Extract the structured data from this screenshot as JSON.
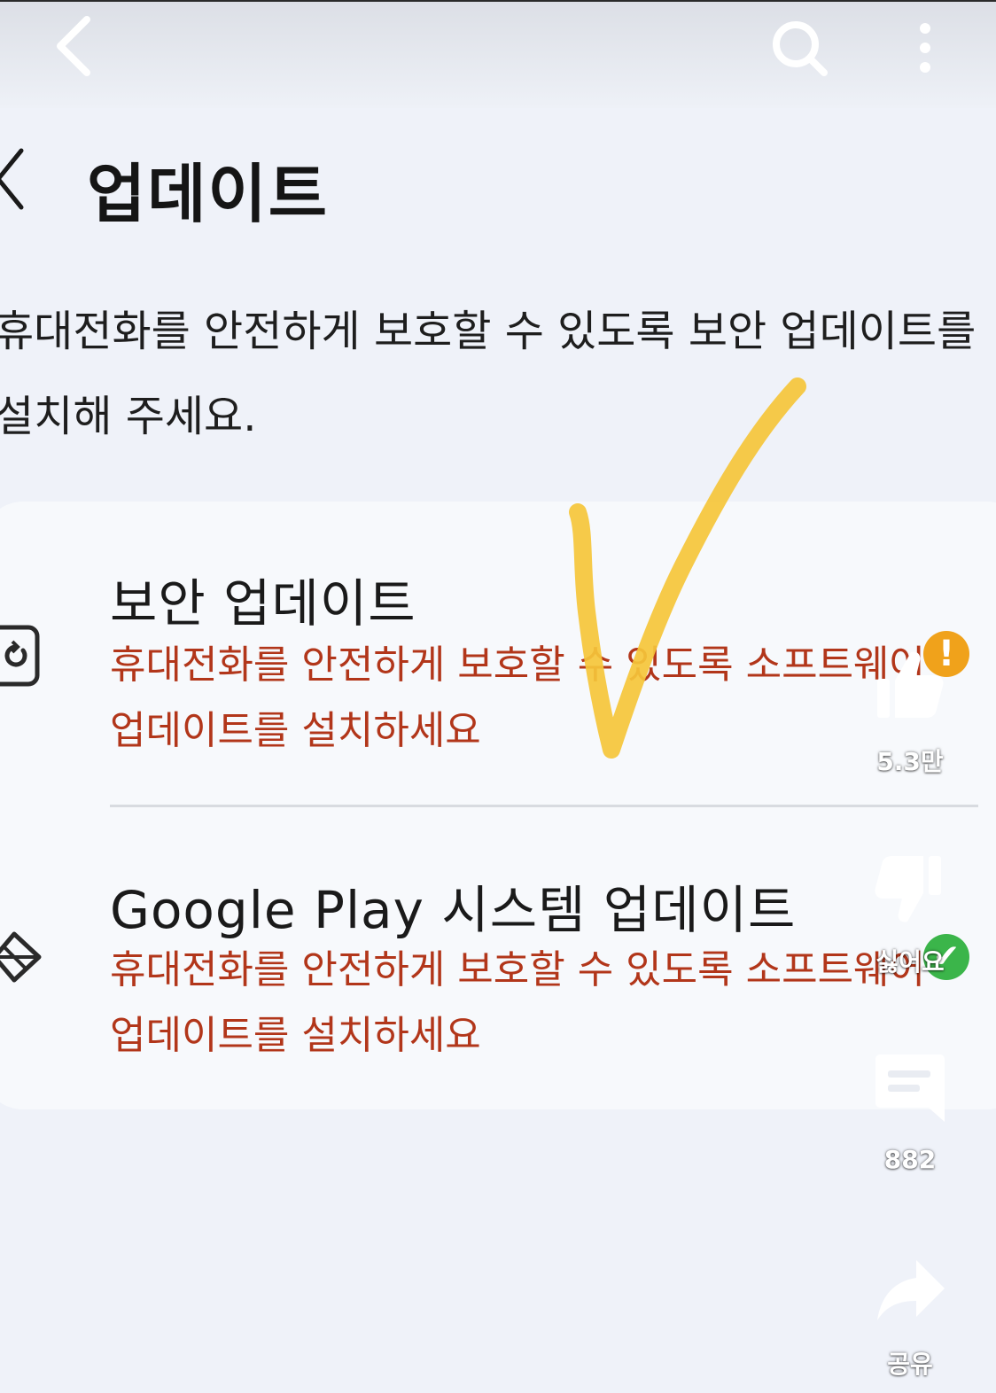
{
  "page": {
    "title": "업데이트",
    "description_lines": [
      "휴대전화를 안전하게 보호할 수 있도록 보안 업데이트를",
      "설치해 주세요."
    ]
  },
  "items": [
    {
      "title": "보안 업데이트",
      "desc_lines": [
        "휴대전화를 안전하게 보호할 수 있도록 소프트웨어",
        "업데이트를 설치하세요"
      ],
      "status_icon": "warning-icon",
      "status_color": "#f0a21b"
    },
    {
      "title": "Google Play 시스템 업데이트",
      "desc_lines": [
        "휴대전화를 안전하게 보호할 수 있도록 소프트웨어",
        "업데이트를 설치하세요"
      ],
      "status_icon": "check-circle-icon",
      "status_color": "#3bb54a"
    }
  ],
  "overlay": {
    "like_count": "5.3만",
    "dislike_label": "싫어요",
    "comment_count": "882",
    "share_label": "공유"
  },
  "colors": {
    "accent_text": "#b2361a",
    "annotation": "#f5c63a"
  }
}
